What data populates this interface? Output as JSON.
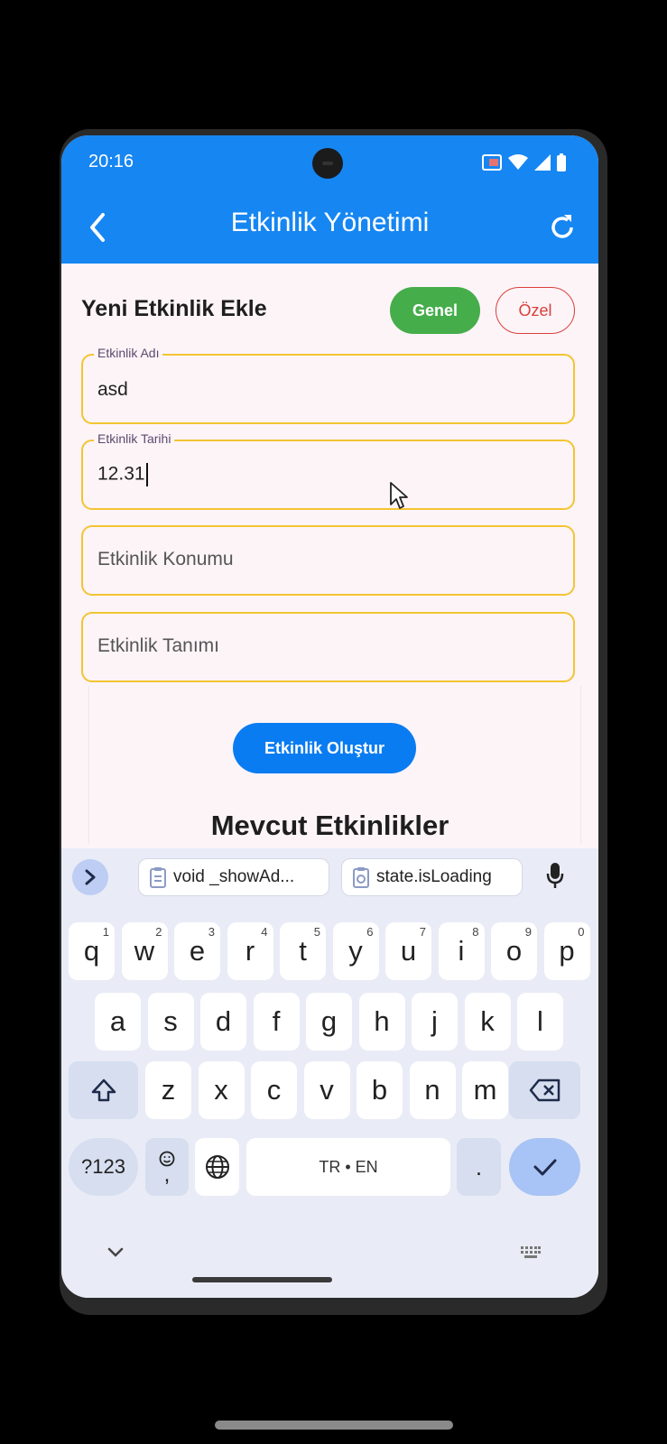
{
  "status_bar": {
    "time": "20:16"
  },
  "app_bar": {
    "title": "Etkinlik Yönetimi"
  },
  "form": {
    "section_title": "Yeni Etkinlik Ekle",
    "genel_label": "Genel",
    "ozel_label": "Özel",
    "name_label": "Etkinlik Adı",
    "name_value": "asd",
    "date_label": "Etkinlik Tarihi",
    "date_value": "12.31",
    "location_placeholder": "Etkinlik Konumu",
    "description_placeholder": "Etkinlik Tanımı",
    "create_button": "Etkinlik Oluştur"
  },
  "existing_title": "Mevcut Etkinlikler",
  "keyboard": {
    "suggestions": [
      "void _showAd...",
      "state.isLoading"
    ],
    "row1": [
      "q",
      "w",
      "e",
      "r",
      "t",
      "y",
      "u",
      "i",
      "o",
      "p"
    ],
    "row1_nums": [
      "1",
      "2",
      "3",
      "4",
      "5",
      "6",
      "7",
      "8",
      "9",
      "0"
    ],
    "row2": [
      "a",
      "s",
      "d",
      "f",
      "g",
      "h",
      "j",
      "k",
      "l"
    ],
    "row3": [
      "z",
      "x",
      "c",
      "v",
      "b",
      "n",
      "m"
    ],
    "sym_label": "?123",
    "emoji_comma": ",",
    "space_label": "TR • EN",
    "period_label": "."
  },
  "colors": {
    "primary": "#1686f2",
    "accent_green": "#46ad4b",
    "accent_red": "#d9403b",
    "field_border": "#f2c531"
  }
}
